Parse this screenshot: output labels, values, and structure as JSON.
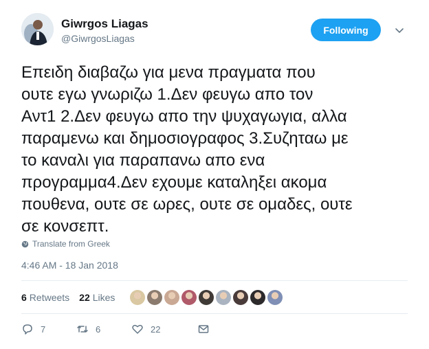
{
  "author": {
    "name": "Giwrgos Liagas",
    "handle": "@GiwrgosLiagas"
  },
  "follow_button": {
    "label": "Following"
  },
  "tweet": {
    "text": "Επειδη διαβαζω για μενα πραγματα που\nουτε εγω γνωριζω 1.Δεν φευγω απο τον\nΑντ1 2.Δεν φευγω απο την ψυχαγωγια, αλλα\nπαραμενω και δημοσιογραφος 3.Συζηταω με\nτο καναλι για παραπανω απο ενα\nπρογραμμα4.Δεν εχουμε καταληξει ακομα\nπουθενα, ουτε σε ωρες, ουτε σε ομαδες, ουτε\nσε κονσεπτ.",
    "translate_label": "Translate from Greek",
    "timestamp": "4:46 AM - 18 Jan 2018"
  },
  "stats": {
    "retweets_count": "6",
    "retweets_label": "Retweets",
    "likes_count": "22",
    "likes_label": "Likes"
  },
  "likers": [
    {
      "color": "#d9c8a2"
    },
    {
      "color": "#8a7b6e"
    },
    {
      "color": "#c9a894"
    },
    {
      "color": "#b05a6a"
    },
    {
      "color": "#3f3a36"
    },
    {
      "color": "#aab4c0"
    },
    {
      "color": "#4a3b3b"
    },
    {
      "color": "#2d2a2c"
    },
    {
      "color": "#7f8fb5"
    }
  ],
  "actions": {
    "replies": "7",
    "retweets": "6",
    "likes": "22"
  },
  "colors": {
    "accent": "#1da1f2",
    "secondary_text": "#657786",
    "divider": "#e6ecf0"
  }
}
